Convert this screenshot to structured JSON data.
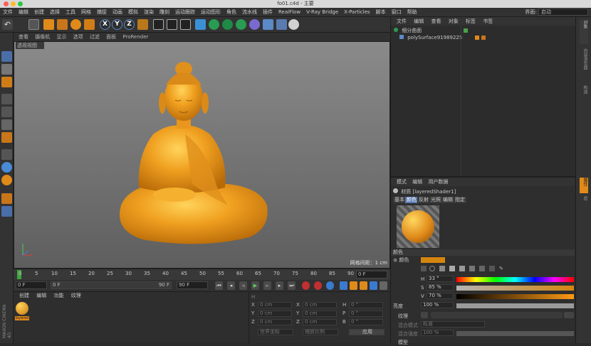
{
  "window": {
    "title": "fo01.c4d - 主要"
  },
  "menubar": {
    "items": [
      "文件",
      "编辑",
      "创建",
      "选择",
      "工具",
      "网格",
      "捕捉",
      "动画",
      "模拟",
      "渲染",
      "雕刻",
      "运动跟踪",
      "运动图形",
      "角色",
      "流水线",
      "插件",
      "RealFlow",
      "V-Ray Bridge",
      "X-Particles",
      "脚本",
      "窗口",
      "帮助"
    ],
    "layout_label": "界面:",
    "layout_value": "启动"
  },
  "toolbar": {
    "axis_buttons": [
      "X",
      "Y",
      "Z"
    ]
  },
  "viewport": {
    "menu": [
      "查看",
      "摄像机",
      "显示",
      "选项",
      "过滤",
      "面板",
      "ProRender"
    ],
    "label": "透视视图",
    "grid_info": "网格间距：1 cm"
  },
  "timeline": {
    "ticks": [
      "0",
      "5",
      "10",
      "15",
      "20",
      "25",
      "30",
      "35",
      "40",
      "45",
      "50",
      "55",
      "60",
      "65",
      "70",
      "75",
      "80",
      "85",
      "90"
    ],
    "current_frame": "0 F"
  },
  "transport": {
    "start": "0 F",
    "range_start": "0 F",
    "range_end": "90 F",
    "end": "90 F"
  },
  "material_manager": {
    "menu": [
      "创建",
      "编辑",
      "功能",
      "纹理"
    ],
    "material_name": "layered"
  },
  "coordinates": {
    "rows": [
      {
        "l1": "X",
        "v1": "0 cm",
        "l2": "X",
        "v2": "0 cm",
        "l3": "H",
        "v3": "0 °"
      },
      {
        "l1": "Y",
        "v1": "0 cm",
        "l2": "Y",
        "v2": "0 cm",
        "l3": "P",
        "v3": "0 °"
      },
      {
        "l1": "Z",
        "v1": "0 cm",
        "l2": "Z",
        "v2": "0 cm",
        "l3": "B",
        "v3": "0 °"
      }
    ],
    "world_label": "世界坐标",
    "scale_label": "缩放比例",
    "apply_label": "应用"
  },
  "object_manager": {
    "menu": [
      "文件",
      "编辑",
      "查看",
      "对象",
      "标签",
      "书签"
    ],
    "objects": [
      {
        "name": "细分曲面"
      },
      {
        "name": "polySurface91989225"
      }
    ]
  },
  "attribute_manager": {
    "menu": [
      "模式",
      "编辑",
      "用户数据"
    ],
    "material_title": "材质 [layeredShader1]",
    "tabs": [
      "基本",
      "颜色",
      "反射",
      "光照",
      "编辑",
      "指定"
    ],
    "section": "颜色",
    "color_label": "颜色",
    "h_label": "H",
    "h_value": "33 °",
    "s_label": "S",
    "s_value": "85 %",
    "v_label": "V",
    "v_value": "70 %",
    "brightness_label": "亮度",
    "brightness_value": "100 %",
    "texture_label": "纹理",
    "mix_mode_label": "混合模式",
    "mix_mode_value": "标准",
    "mix_strength_label": "混合强度",
    "mix_strength_value": "100 %",
    "model_label": "模型"
  },
  "side_strip": {
    "tabs": [
      "对象",
      "内容浏览器",
      "构造",
      "属性",
      "层"
    ]
  },
  "colors": {
    "accent": "#e08a1a",
    "swatch": "#d5860f"
  }
}
